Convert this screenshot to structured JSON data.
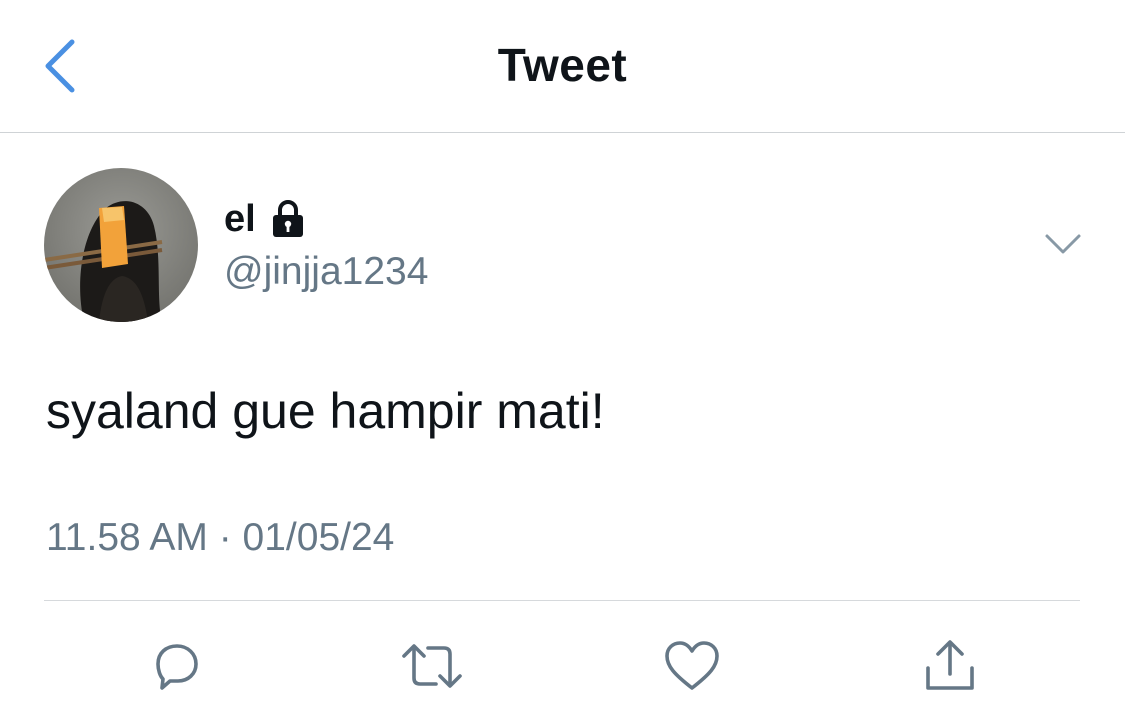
{
  "header": {
    "title": "Tweet",
    "back_icon": "chevron-left-icon",
    "accent_color": "#4a90e2"
  },
  "tweet": {
    "author": {
      "display_name": "el",
      "protected_icon": "lock-icon",
      "handle": "@jinjja1234"
    },
    "text": "syaland gue hampir mati!",
    "timestamp": "11.58 AM · 01/05/24",
    "menu_icon": "chevron-down-icon"
  },
  "actions": [
    {
      "icon": "reply-icon"
    },
    {
      "icon": "retweet-icon"
    },
    {
      "icon": "like-icon"
    },
    {
      "icon": "share-icon"
    }
  ],
  "colors": {
    "text": "#0f1419",
    "secondary": "#657786",
    "divider": "#d6d9dc",
    "icon": "#657786"
  }
}
